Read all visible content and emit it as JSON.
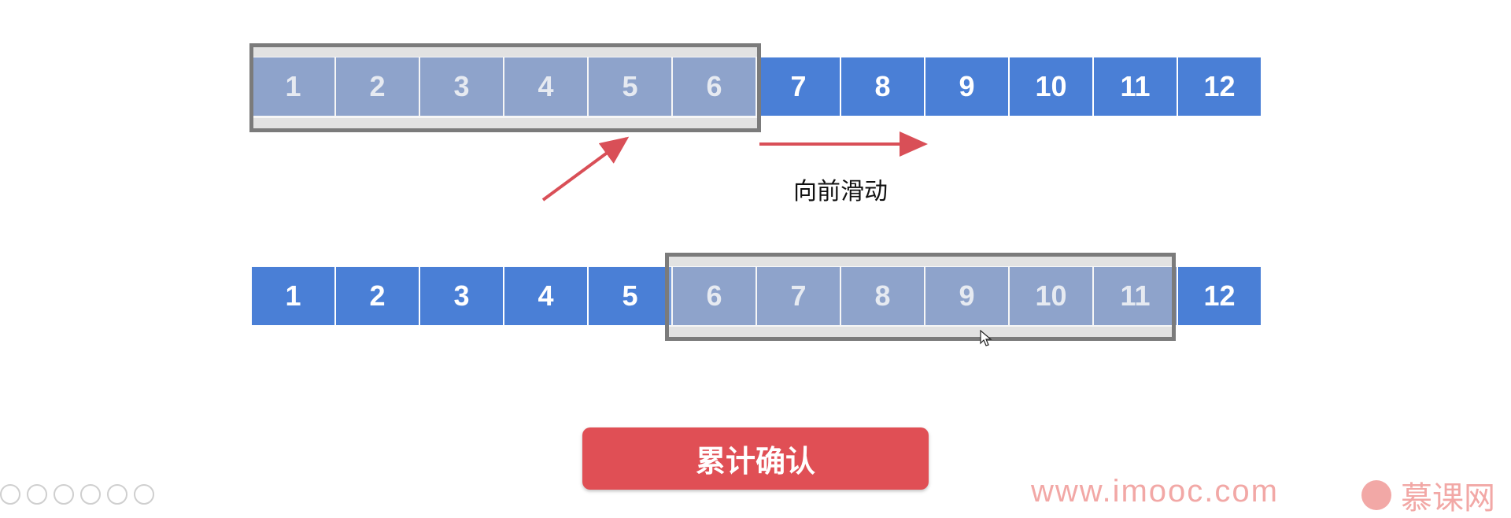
{
  "top_row": {
    "cells": [
      "1",
      "2",
      "3",
      "4",
      "5",
      "6",
      "7",
      "8",
      "9",
      "10",
      "11",
      "12"
    ],
    "window_range": [
      1,
      6
    ]
  },
  "bottom_row": {
    "cells": [
      "1",
      "2",
      "3",
      "4",
      "5",
      "6",
      "7",
      "8",
      "9",
      "10",
      "11",
      "12"
    ],
    "window_range": [
      6,
      11
    ]
  },
  "slide_label": "向前滑动",
  "confirm_button": {
    "label": "累计确认"
  },
  "watermark": {
    "url": "www.imooc.com",
    "brand": "慕课网"
  },
  "colors": {
    "cell": "#4a7fd6",
    "cell_in_window": "#6a88c2",
    "window_border": "#7b7b7b",
    "arrow": "#d94f57",
    "button": "#e04f55"
  },
  "icons": [
    "arrow-diagonal-icon",
    "arrow-right-icon",
    "mouse-cursor-icon",
    "imooc-logo-icon"
  ]
}
